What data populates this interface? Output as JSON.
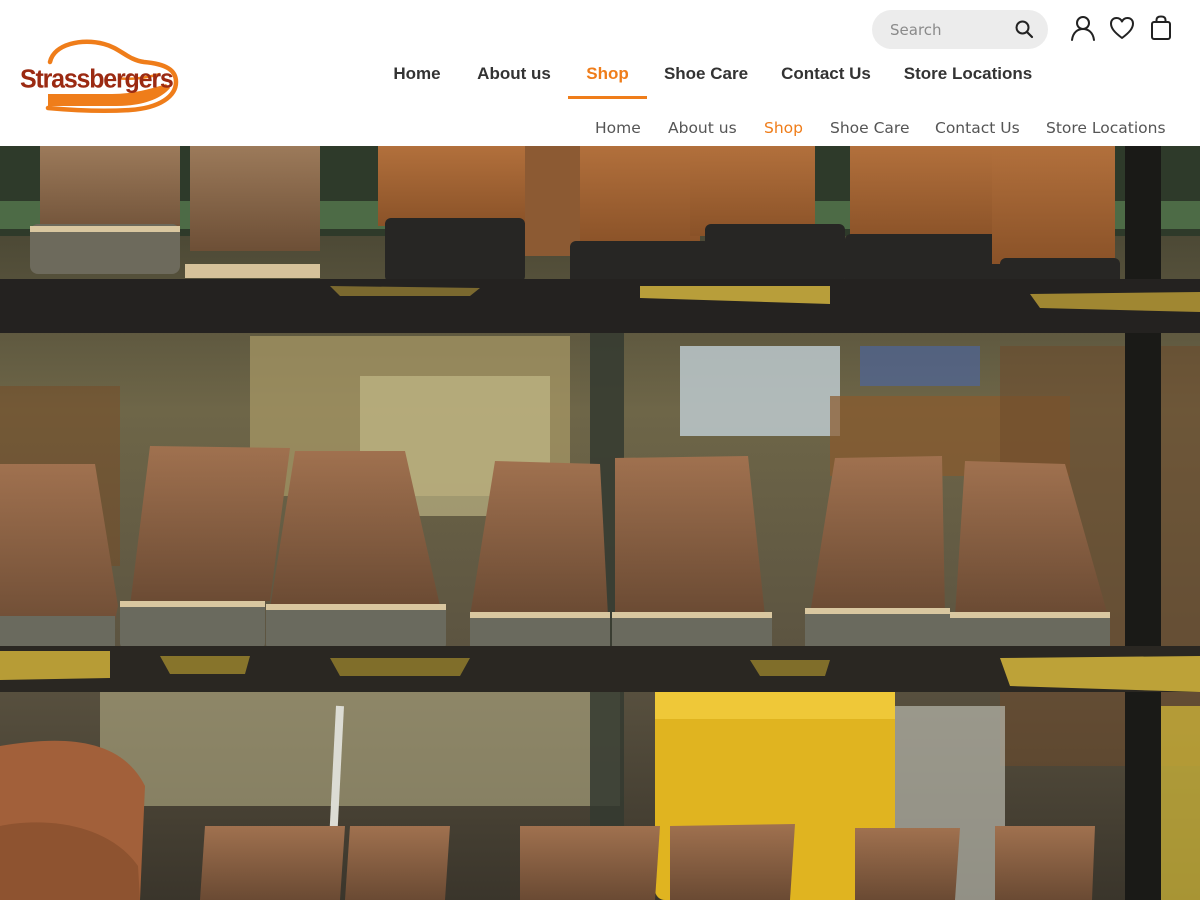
{
  "brand": {
    "name": "Strassbergers",
    "accent": "#ef7d1a",
    "logo_text_color": "#9b2a12"
  },
  "search": {
    "placeholder": "Search",
    "value": "",
    "icon": "search-icon"
  },
  "header_icons": [
    {
      "name": "account-icon",
      "label": "Account"
    },
    {
      "name": "heart-icon",
      "label": "Wishlist"
    },
    {
      "name": "shopping-bag-icon",
      "label": "Cart"
    }
  ],
  "nav_primary": {
    "items": [
      {
        "label": "Home",
        "active": false
      },
      {
        "label": "About us",
        "active": false
      },
      {
        "label": "Shop",
        "active": true
      },
      {
        "label": "Shoe Care",
        "active": false
      },
      {
        "label": "Contact Us",
        "active": false
      },
      {
        "label": "Store Locations",
        "active": false
      }
    ]
  },
  "nav_secondary": {
    "items": [
      {
        "label": "Home",
        "active": false
      },
      {
        "label": "About us",
        "active": false
      },
      {
        "label": "Shop",
        "active": true
      },
      {
        "label": "Shoe Care",
        "active": false
      },
      {
        "label": "Contact Us",
        "active": false
      },
      {
        "label": "Store Locations",
        "active": false
      }
    ]
  },
  "hero": {
    "image": "boots-on-workshop-shelves-photo"
  }
}
